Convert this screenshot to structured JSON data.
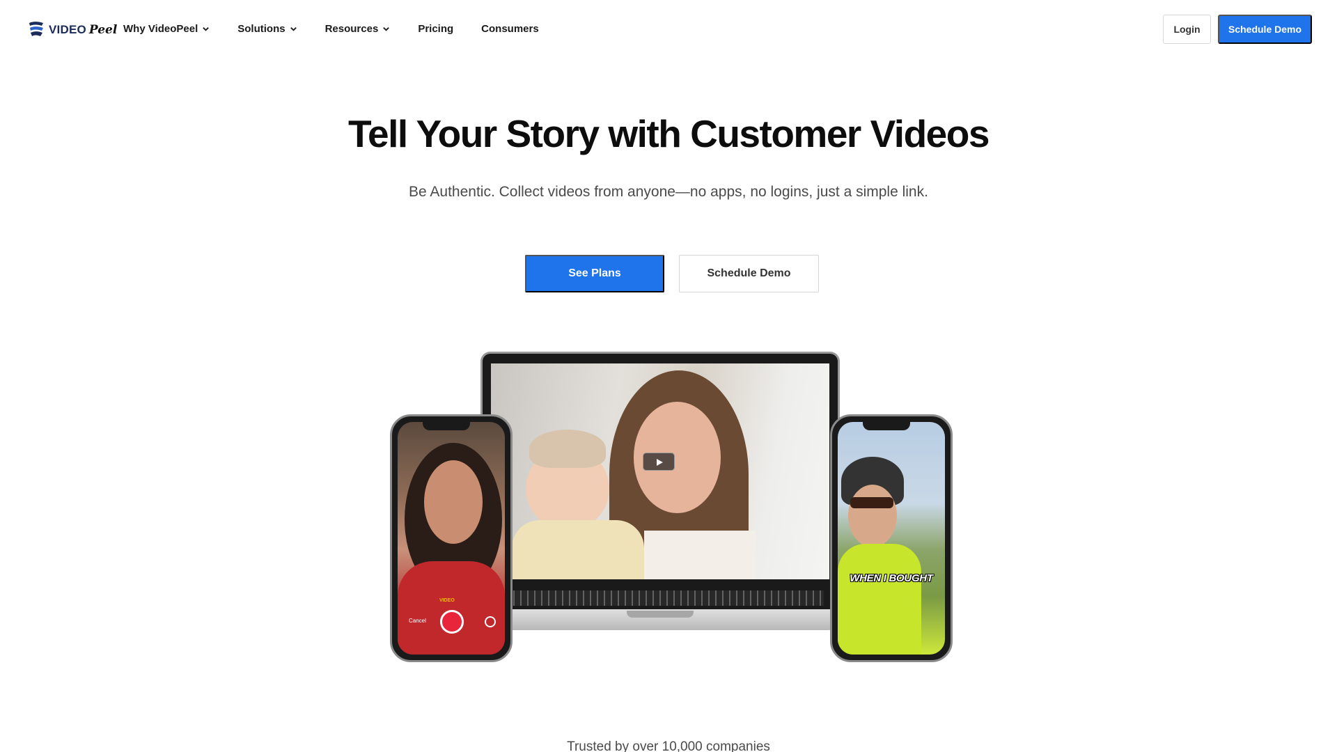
{
  "nav": {
    "logo_text": "VIDEO",
    "logo_script": "Peel",
    "items": [
      {
        "label": "Why VideoPeel",
        "has_dropdown": true
      },
      {
        "label": "Solutions",
        "has_dropdown": true
      },
      {
        "label": "Resources",
        "has_dropdown": true
      },
      {
        "label": "Pricing",
        "has_dropdown": false
      },
      {
        "label": "Consumers",
        "has_dropdown": false
      }
    ],
    "login_label": "Login",
    "demo_label": "Schedule Demo"
  },
  "hero": {
    "title": "Tell Your Story with Customer Videos",
    "subtitle": "Be Authentic. Collect videos from anyone—no apps, no logins, just a simple link.",
    "primary_button": "See Plans",
    "secondary_button": "Schedule Demo"
  },
  "devices": {
    "left_phone": {
      "cancel_label": "Cancel",
      "mode_label": "VIDEO"
    },
    "right_phone": {
      "caption": "WHEN I BOUGHT"
    }
  },
  "trusted": "Trusted by over 10,000 companies",
  "colors": {
    "accent": "#1f74ec",
    "record": "#e8253a"
  },
  "icons": {
    "logo": "videopeel-logo-icon",
    "dropdown": "chevron-down-icon",
    "play": "play-icon",
    "record": "record-icon",
    "flip": "camera-flip-icon"
  }
}
